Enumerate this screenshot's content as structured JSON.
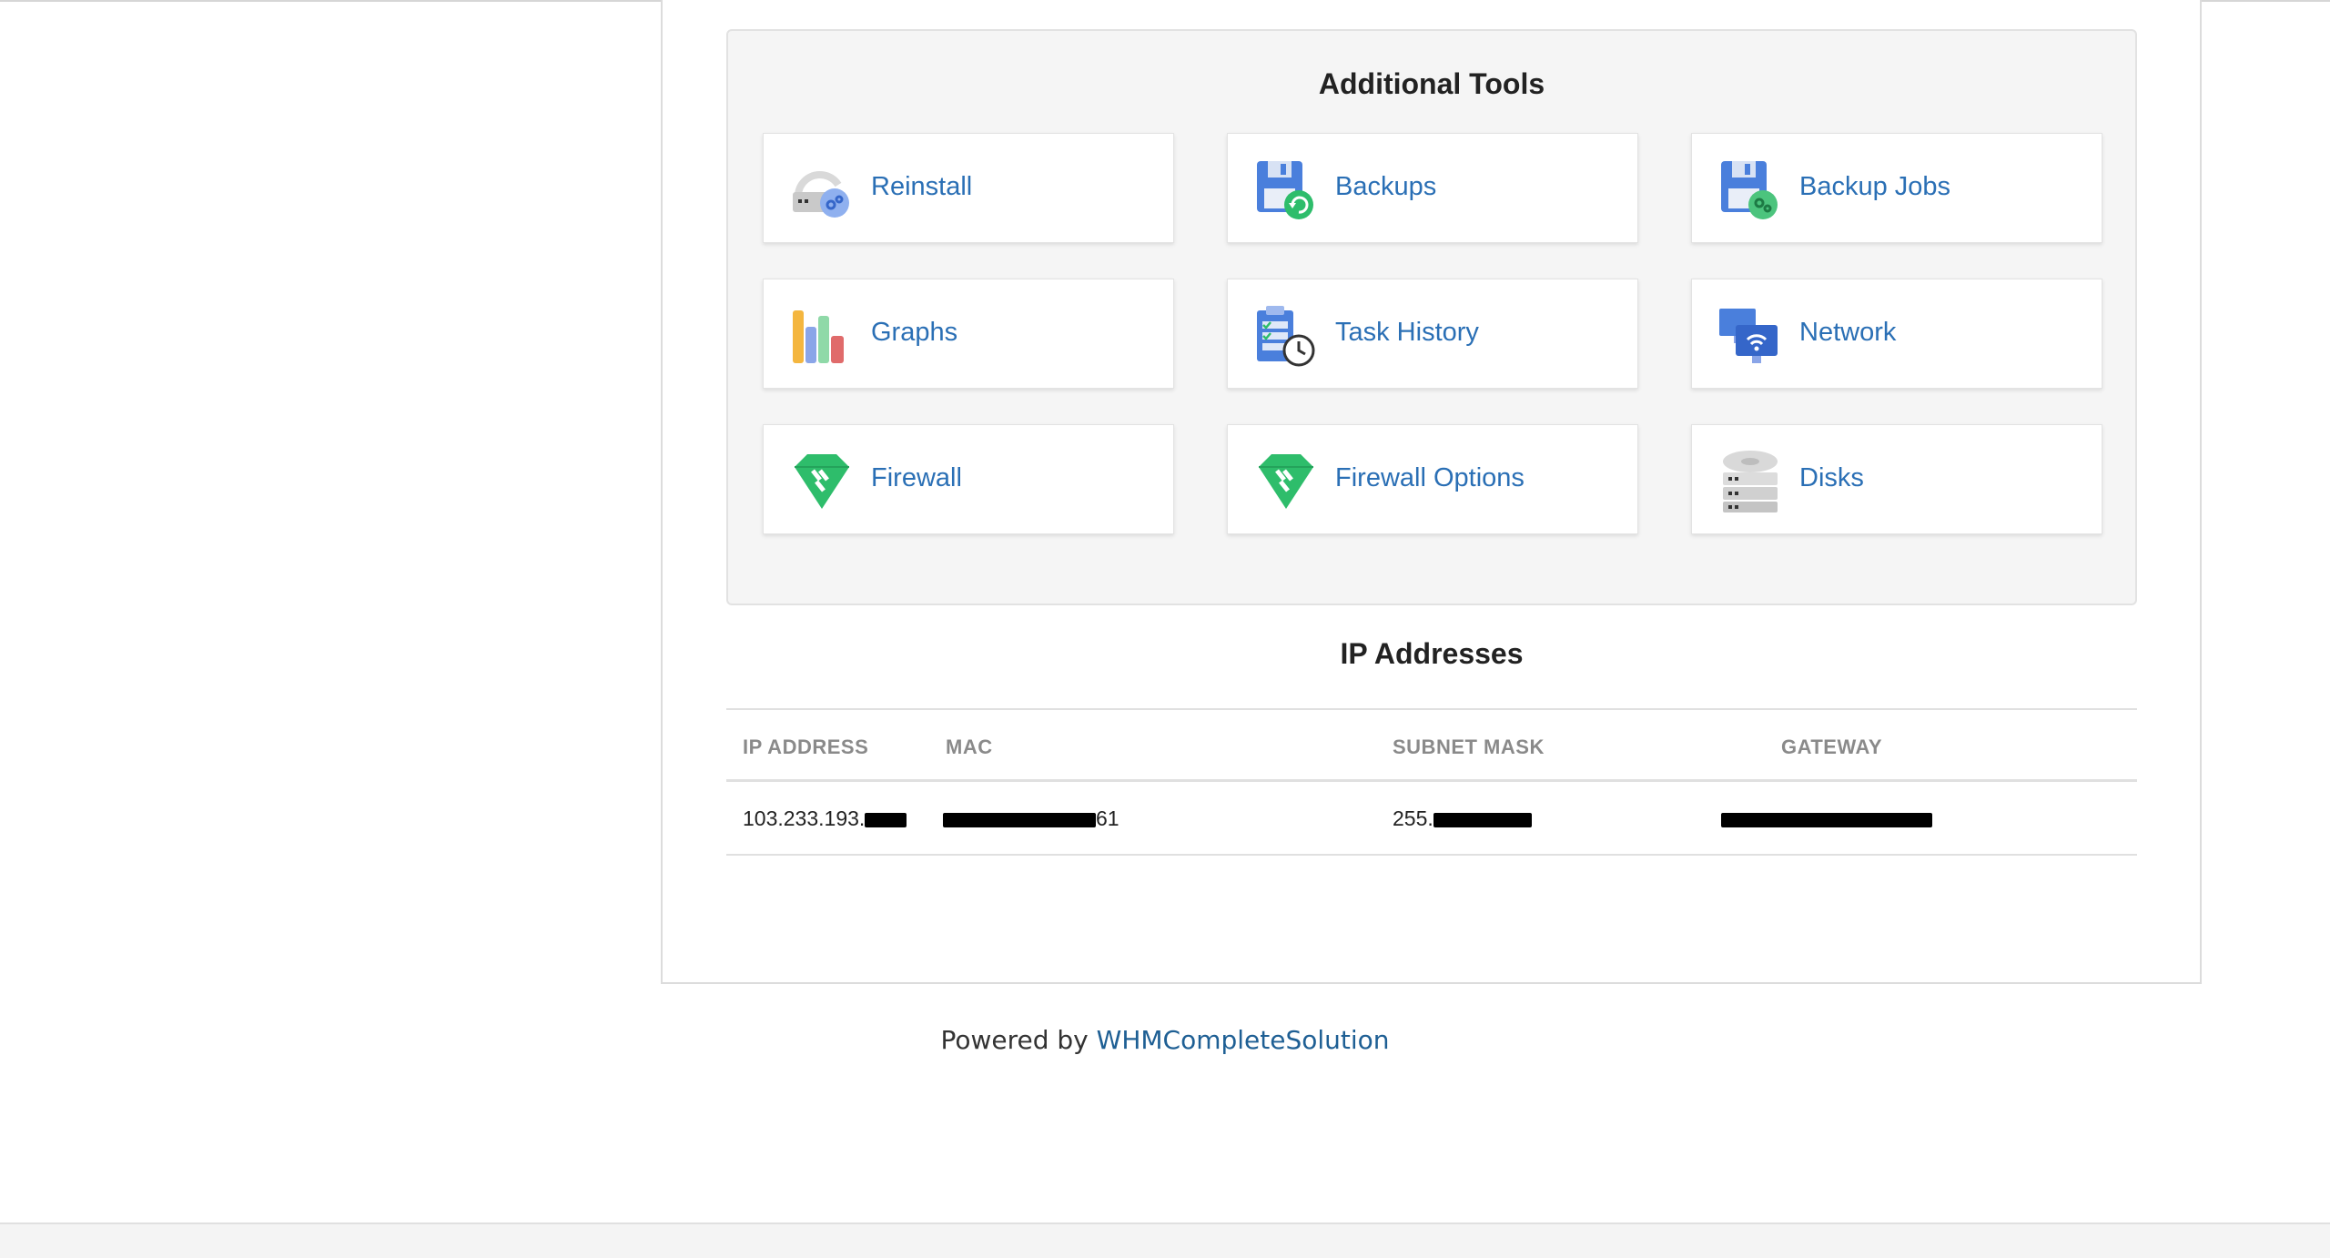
{
  "tools": {
    "title": "Additional Tools",
    "items": [
      {
        "label": "Reinstall",
        "icon": "reinstall-icon"
      },
      {
        "label": "Backups",
        "icon": "backups-icon"
      },
      {
        "label": "Backup Jobs",
        "icon": "backup-jobs-icon"
      },
      {
        "label": "Graphs",
        "icon": "graphs-icon"
      },
      {
        "label": "Task History",
        "icon": "task-history-icon"
      },
      {
        "label": "Network",
        "icon": "network-icon"
      },
      {
        "label": "Firewall",
        "icon": "firewall-icon"
      },
      {
        "label": "Firewall Options",
        "icon": "firewall-options-icon"
      },
      {
        "label": "Disks",
        "icon": "disks-icon"
      }
    ]
  },
  "ip": {
    "title": "IP Addresses",
    "headers": [
      "IP ADDRESS",
      "MAC",
      "SUBNET MASK",
      "GATEWAY"
    ],
    "row": {
      "ip_prefix": "103.233.193.",
      "mac_suffix": "61",
      "subnet_prefix": "255."
    }
  },
  "footer": {
    "prefix": "Powered by ",
    "link": "WHMCompleteSolution"
  },
  "colors": {
    "link": "#2a6fb5",
    "footer_link": "#1e5f94",
    "green": "#2ebd6b",
    "blue": "#4a7fdc"
  }
}
